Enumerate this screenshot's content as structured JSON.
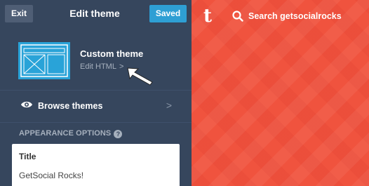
{
  "toolbar": {
    "exit_label": "Exit",
    "title": "Edit theme",
    "saved_label": "Saved"
  },
  "theme": {
    "name": "Custom theme",
    "edit_html_label": "Edit HTML",
    "edit_html_chevron": ">"
  },
  "browse": {
    "icon": "eye-icon",
    "label": "Browse themes",
    "chevron": ">"
  },
  "appearance": {
    "section_label": "APPEARANCE OPTIONS",
    "help_icon": "?",
    "title_field": {
      "label": "Title",
      "value": "GetSocial Rocks!"
    }
  },
  "preview": {
    "logo": "t",
    "search_placeholder": "Search getsocialrocks",
    "accent": "#f0533e"
  },
  "colors": {
    "panel": "#36465d",
    "saved_button": "#2e9fd4",
    "theme_thumb": "#29a3d8"
  }
}
